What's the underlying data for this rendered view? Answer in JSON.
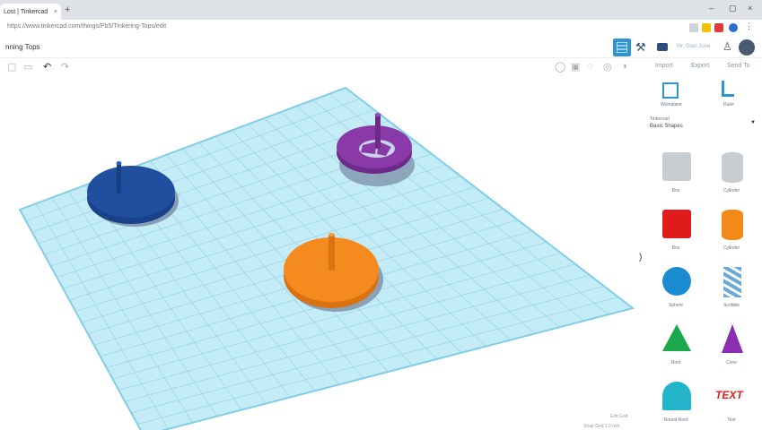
{
  "browser": {
    "tab_title": "Lost | Tinkercad",
    "tab_close": "×",
    "new_tab": "+",
    "url": "https://www.tinkercad.com/things/Pb5/Tinkering-Tops/edit",
    "window_controls": [
      "–",
      "▢",
      "×"
    ]
  },
  "app": {
    "project_title": "nning Tops",
    "username": "Mr. Gian Jone",
    "right_tabs": [
      "Import",
      "Export",
      "Send To"
    ],
    "panel_tools": [
      {
        "label": "Workplane"
      },
      {
        "label": "Ruler"
      }
    ],
    "category_label": "Tinkercad",
    "category_value": "Basic Shapes",
    "shapes": [
      {
        "label": "Box",
        "color": "#c8cdd2"
      },
      {
        "label": "Cylinder",
        "color": "#c8cdd2"
      },
      {
        "label": "Box",
        "color": "#e01b1b"
      },
      {
        "label": "Cylinder",
        "color": "#f28a1a"
      },
      {
        "label": "Sphere",
        "color": "#1a8bd1"
      },
      {
        "label": "Scribble",
        "color": "#6aa8d8"
      },
      {
        "label": "Roof",
        "color": "#1aa84a"
      },
      {
        "label": "Cone",
        "color": "#8a2fb0"
      },
      {
        "label": "Round Roof",
        "color": "#22b4c8"
      },
      {
        "label": "Text",
        "color": "#e01b1b"
      }
    ],
    "text_shape_glyph": "TEXT",
    "collapse_glyph": ")",
    "zoom_label": "Edit Grid",
    "snap_label": "Snap Grid  1.0 mm",
    "colors": {
      "accent": "#2e95d3",
      "grid": "#bfe7f3",
      "grid_line": "#8fd0e6",
      "top_blue": "#1f4f9e",
      "top_purple": "#8a3aa8",
      "top_orange": "#f58a1e"
    }
  }
}
